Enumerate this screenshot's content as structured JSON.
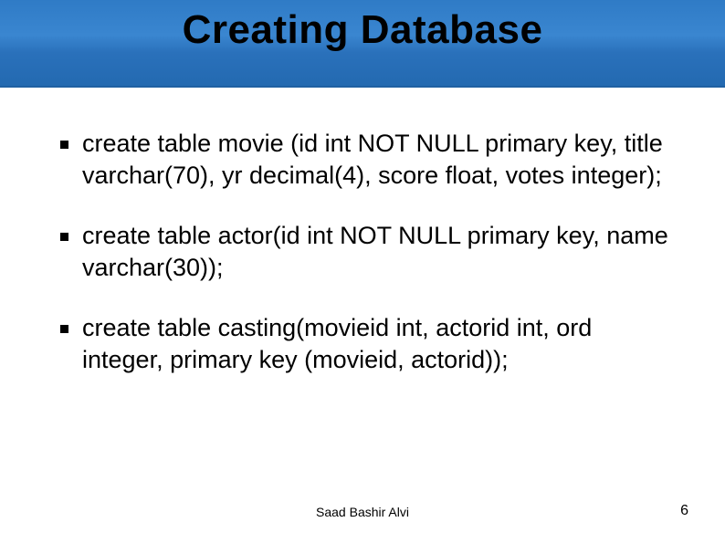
{
  "slide": {
    "title": "Creating Database",
    "bullets": [
      "create table movie (id int NOT NULL primary key, title varchar(70), yr decimal(4), score float, votes integer);",
      "create table actor(id int NOT NULL primary key, name varchar(30));",
      "create table casting(movieid int, actorid int, ord integer, primary key (movieid, actorid));"
    ],
    "footer_author": "Saad Bashir Alvi",
    "page_number": "6"
  }
}
